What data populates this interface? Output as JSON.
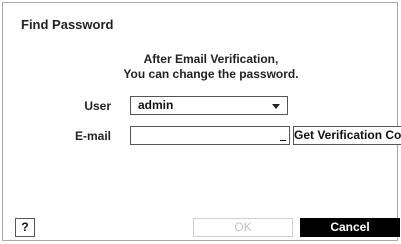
{
  "dialog": {
    "title": "Find Password",
    "message_line1": "After Email Verification,",
    "message_line2": "You can change the password."
  },
  "form": {
    "user_label": "User",
    "user_value": "admin",
    "email_label": "E-mail",
    "email_value": "",
    "verify_button": "Get Verification Code"
  },
  "footer": {
    "help_label": "?",
    "ok_label": "OK",
    "ok_enabled": false,
    "cancel_label": "Cancel"
  }
}
